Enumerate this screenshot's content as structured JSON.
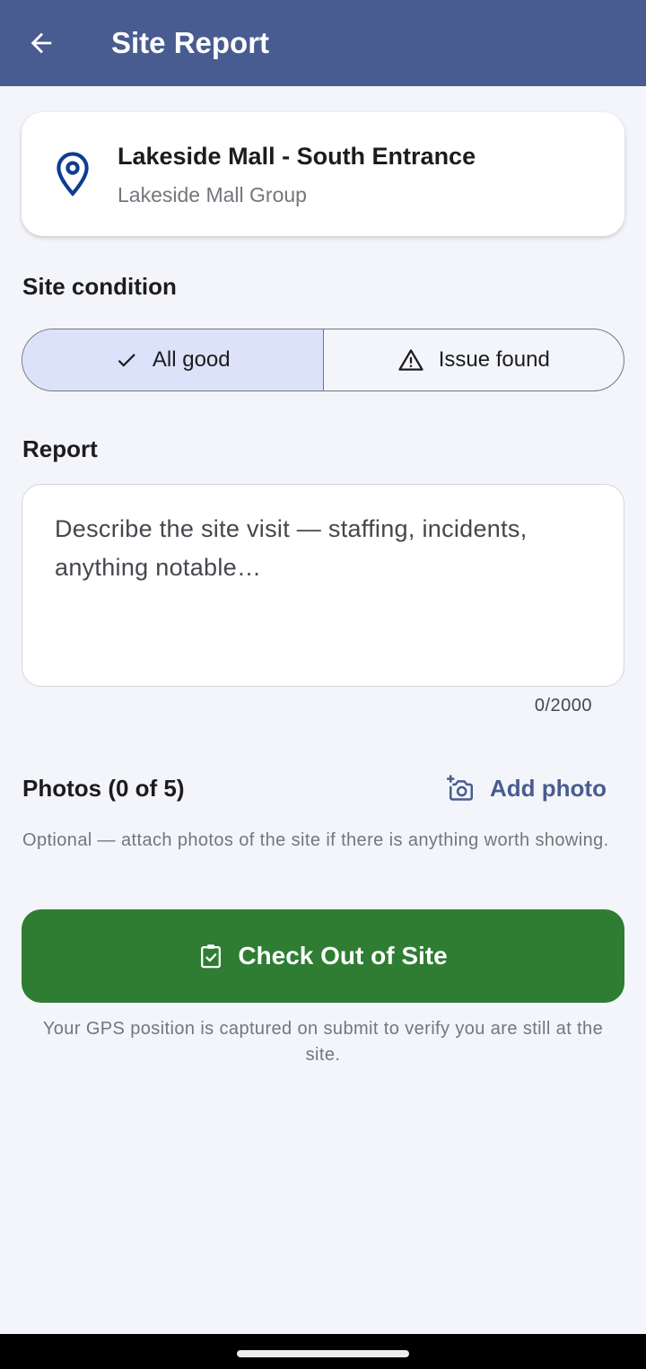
{
  "appbar": {
    "title": "Site Report",
    "back_icon": "arrow-left-icon"
  },
  "site": {
    "name": "Lakeside Mall - South Entrance",
    "organization": "Lakeside Mall Group",
    "icon": "location-pin-icon"
  },
  "condition": {
    "label": "Site condition",
    "options": [
      {
        "label": "All good",
        "icon": "check-icon",
        "selected": true
      },
      {
        "label": "Issue found",
        "icon": "warning-icon",
        "selected": false
      }
    ]
  },
  "report": {
    "label": "Report",
    "value": "",
    "placeholder": "Describe the site visit — staffing, incidents, anything notable…",
    "char_count": "0/2000"
  },
  "photos": {
    "label": "Photos (0 of 5)",
    "add_label": "Add photo",
    "add_icon": "add-camera-icon",
    "hint": "Optional — attach photos of the site if there is anything worth showing."
  },
  "checkout": {
    "label": "Check Out of Site",
    "icon": "clipboard-check-icon",
    "note": "Your GPS position is captured on submit to verify you are still at the site."
  },
  "colors": {
    "primary": "#485c91",
    "success": "#2e7d32",
    "selected_segment": "#dce2f9",
    "background": "#f3f5fa"
  }
}
